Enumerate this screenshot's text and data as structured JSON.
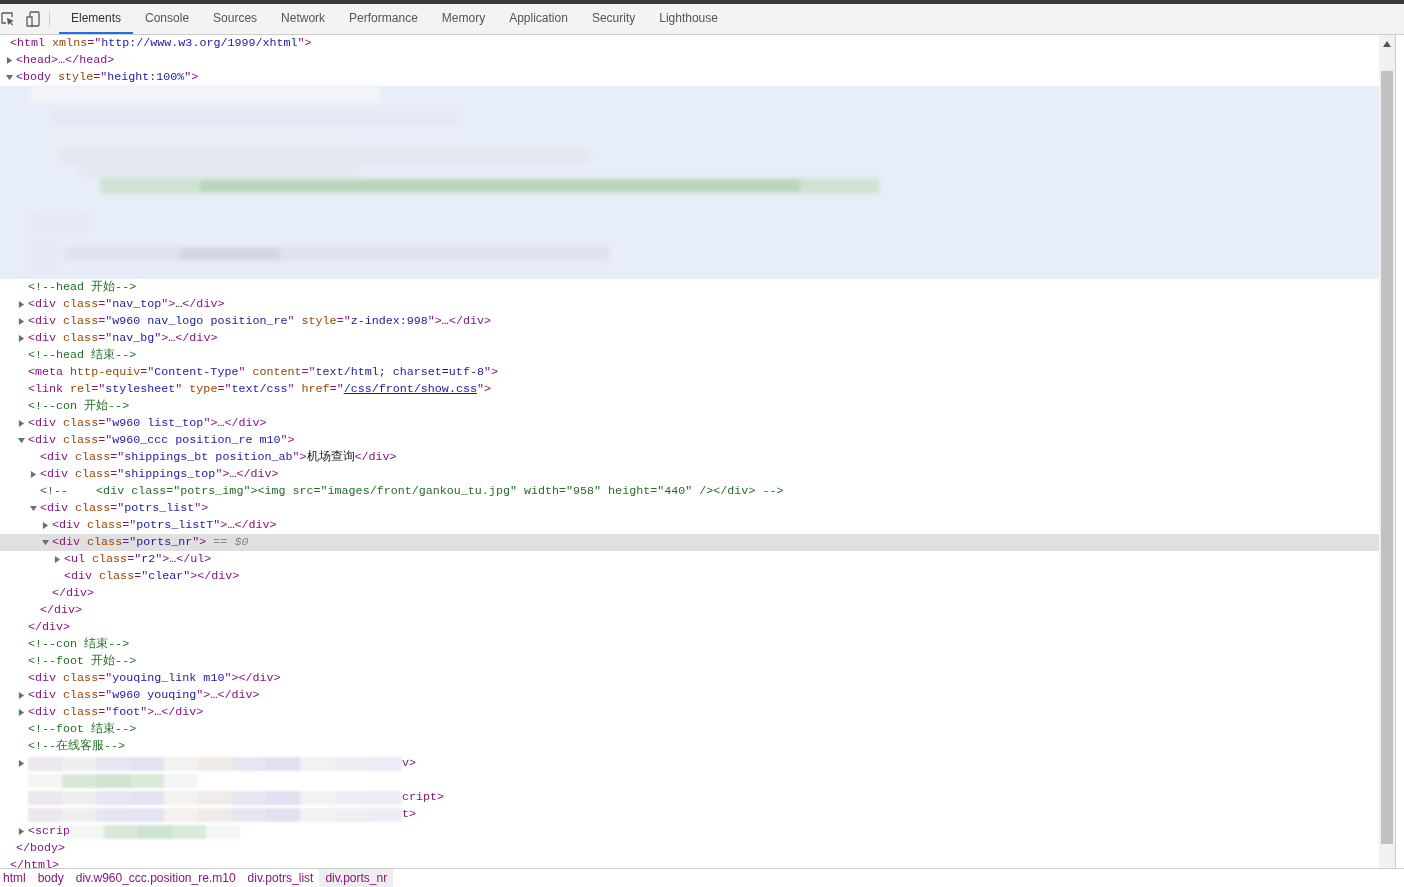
{
  "toolbar": {
    "tabs": [
      {
        "label": "Elements",
        "selected": true
      },
      {
        "label": "Console",
        "selected": false
      },
      {
        "label": "Sources",
        "selected": false
      },
      {
        "label": "Network",
        "selected": false
      },
      {
        "label": "Performance",
        "selected": false
      },
      {
        "label": "Memory",
        "selected": false
      },
      {
        "label": "Application",
        "selected": false
      },
      {
        "label": "Security",
        "selected": false
      },
      {
        "label": "Lighthouse",
        "selected": false
      }
    ]
  },
  "tree": [
    {
      "kind": "element",
      "parts": [
        {
          "kind": "tag",
          "text": "<html"
        },
        {
          "kind": "attr",
          "text": " xmlns"
        },
        {
          "kind": "tag",
          "text": "=\""
        },
        {
          "kind": "value",
          "text": "http://www.w3.org/1999/xhtml"
        },
        {
          "kind": "tag",
          "text": "\">"
        }
      ],
      "children": [
        {
          "kind": "element",
          "expanded": false,
          "parts": [
            {
              "kind": "tag",
              "text": "<head>"
            },
            {
              "kind": "text",
              "text": "…"
            },
            {
              "kind": "tag",
              "text": "</head>"
            }
          ]
        },
        {
          "kind": "element",
          "expanded": true,
          "parts": [
            {
              "kind": "tag",
              "text": "<body"
            },
            {
              "kind": "attr",
              "text": " style"
            },
            {
              "kind": "tag",
              "text": "=\""
            },
            {
              "kind": "value",
              "text": "height:100%"
            },
            {
              "kind": "tag",
              "text": "\">"
            }
          ],
          "closing": [
            {
              "kind": "tag",
              "text": "</body>"
            }
          ],
          "children": [
            {
              "kind": "redacted_block",
              "highlighted": true
            },
            {
              "kind": "element",
              "parts": [
                {
                  "kind": "comment",
                  "text": "<!--head 开始-->"
                }
              ]
            },
            {
              "kind": "element",
              "expanded": false,
              "parts": [
                {
                  "kind": "tag",
                  "text": "<div"
                },
                {
                  "kind": "attr",
                  "text": " class"
                },
                {
                  "kind": "tag",
                  "text": "=\""
                },
                {
                  "kind": "value",
                  "text": "nav_top"
                },
                {
                  "kind": "tag",
                  "text": "\">"
                },
                {
                  "kind": "text",
                  "text": "…"
                },
                {
                  "kind": "tag",
                  "text": "</div>"
                }
              ]
            },
            {
              "kind": "element",
              "expanded": false,
              "parts": [
                {
                  "kind": "tag",
                  "text": "<div"
                },
                {
                  "kind": "attr",
                  "text": " class"
                },
                {
                  "kind": "tag",
                  "text": "=\""
                },
                {
                  "kind": "value",
                  "text": "w960 nav_logo position_re"
                },
                {
                  "kind": "tag",
                  "text": "\""
                },
                {
                  "kind": "attr",
                  "text": " style"
                },
                {
                  "kind": "tag",
                  "text": "=\""
                },
                {
                  "kind": "value",
                  "text": "z-index:998"
                },
                {
                  "kind": "tag",
                  "text": "\">"
                },
                {
                  "kind": "text",
                  "text": "…"
                },
                {
                  "kind": "tag",
                  "text": "</div>"
                }
              ]
            },
            {
              "kind": "element",
              "expanded": false,
              "parts": [
                {
                  "kind": "tag",
                  "text": "<div"
                },
                {
                  "kind": "attr",
                  "text": " class"
                },
                {
                  "kind": "tag",
                  "text": "=\""
                },
                {
                  "kind": "value",
                  "text": "nav_bg"
                },
                {
                  "kind": "tag",
                  "text": "\">"
                },
                {
                  "kind": "text",
                  "text": "…"
                },
                {
                  "kind": "tag",
                  "text": "</div>"
                }
              ]
            },
            {
              "kind": "element",
              "parts": [
                {
                  "kind": "comment",
                  "text": "<!--head 结束-->"
                }
              ]
            },
            {
              "kind": "element",
              "parts": [
                {
                  "kind": "tag",
                  "text": "<meta"
                },
                {
                  "kind": "attr",
                  "text": " http-equiv"
                },
                {
                  "kind": "tag",
                  "text": "=\""
                },
                {
                  "kind": "value",
                  "text": "Content-Type"
                },
                {
                  "kind": "tag",
                  "text": "\""
                },
                {
                  "kind": "attr",
                  "text": " content"
                },
                {
                  "kind": "tag",
                  "text": "=\""
                },
                {
                  "kind": "value",
                  "text": "text/html; charset=utf-8"
                },
                {
                  "kind": "tag",
                  "text": "\">"
                }
              ]
            },
            {
              "kind": "element",
              "parts": [
                {
                  "kind": "tag",
                  "text": "<link"
                },
                {
                  "kind": "attr",
                  "text": " rel"
                },
                {
                  "kind": "tag",
                  "text": "=\""
                },
                {
                  "kind": "value",
                  "text": "stylesheet"
                },
                {
                  "kind": "tag",
                  "text": "\""
                },
                {
                  "kind": "attr",
                  "text": " type"
                },
                {
                  "kind": "tag",
                  "text": "=\""
                },
                {
                  "kind": "value",
                  "text": "text/css"
                },
                {
                  "kind": "tag",
                  "text": "\""
                },
                {
                  "kind": "attr",
                  "text": " href"
                },
                {
                  "kind": "tag",
                  "text": "=\""
                },
                {
                  "kind": "link",
                  "text": "/css/front/show.css"
                },
                {
                  "kind": "tag",
                  "text": "\">"
                }
              ]
            },
            {
              "kind": "element",
              "parts": [
                {
                  "kind": "comment",
                  "text": "<!--con 开始-->"
                }
              ]
            },
            {
              "kind": "element",
              "expanded": false,
              "parts": [
                {
                  "kind": "tag",
                  "text": "<div"
                },
                {
                  "kind": "attr",
                  "text": " class"
                },
                {
                  "kind": "tag",
                  "text": "=\""
                },
                {
                  "kind": "value",
                  "text": "w960 list_top"
                },
                {
                  "kind": "tag",
                  "text": "\">"
                },
                {
                  "kind": "text",
                  "text": "…"
                },
                {
                  "kind": "tag",
                  "text": "</div>"
                }
              ]
            },
            {
              "kind": "element",
              "expanded": true,
              "parts": [
                {
                  "kind": "tag",
                  "text": "<div"
                },
                {
                  "kind": "attr",
                  "text": " class"
                },
                {
                  "kind": "tag",
                  "text": "=\""
                },
                {
                  "kind": "value",
                  "text": "w960_ccc position_re m10"
                },
                {
                  "kind": "tag",
                  "text": "\">"
                }
              ],
              "closing": [
                {
                  "kind": "tag",
                  "text": "</div>"
                }
              ],
              "children": [
                {
                  "kind": "element",
                  "parts": [
                    {
                      "kind": "tag",
                      "text": "<div"
                    },
                    {
                      "kind": "attr",
                      "text": " class"
                    },
                    {
                      "kind": "tag",
                      "text": "=\""
                    },
                    {
                      "kind": "value",
                      "text": "shippings_bt position_ab"
                    },
                    {
                      "kind": "tag",
                      "text": "\">"
                    },
                    {
                      "kind": "text",
                      "text": "机场查询"
                    },
                    {
                      "kind": "tag",
                      "text": "</div>"
                    }
                  ]
                },
                {
                  "kind": "element",
                  "expanded": false,
                  "parts": [
                    {
                      "kind": "tag",
                      "text": "<div"
                    },
                    {
                      "kind": "attr",
                      "text": " class"
                    },
                    {
                      "kind": "tag",
                      "text": "=\""
                    },
                    {
                      "kind": "value",
                      "text": "shippings_top"
                    },
                    {
                      "kind": "tag",
                      "text": "\">"
                    },
                    {
                      "kind": "text",
                      "text": "…"
                    },
                    {
                      "kind": "tag",
                      "text": "</div>"
                    }
                  ]
                },
                {
                  "kind": "element",
                  "parts": [
                    {
                      "kind": "comment",
                      "text": "<!--    <div class=\"potrs_img\"><img src=\"images/front/gankou_tu.jpg\" width=\"958\" height=\"440\" /></div> -->"
                    }
                  ]
                },
                {
                  "kind": "element",
                  "expanded": true,
                  "parts": [
                    {
                      "kind": "tag",
                      "text": "<div"
                    },
                    {
                      "kind": "attr",
                      "text": " class"
                    },
                    {
                      "kind": "tag",
                      "text": "=\""
                    },
                    {
                      "kind": "value",
                      "text": "potrs_list"
                    },
                    {
                      "kind": "tag",
                      "text": "\">"
                    }
                  ],
                  "closing": [
                    {
                      "kind": "tag",
                      "text": "</div>"
                    }
                  ],
                  "children": [
                    {
                      "kind": "element",
                      "expanded": false,
                      "parts": [
                        {
                          "kind": "tag",
                          "text": "<div"
                        },
                        {
                          "kind": "attr",
                          "text": " class"
                        },
                        {
                          "kind": "tag",
                          "text": "=\""
                        },
                        {
                          "kind": "value",
                          "text": "potrs_listT"
                        },
                        {
                          "kind": "tag",
                          "text": "\">"
                        },
                        {
                          "kind": "text",
                          "text": "…"
                        },
                        {
                          "kind": "tag",
                          "text": "</div>"
                        }
                      ]
                    },
                    {
                      "kind": "element",
                      "expanded": true,
                      "selected": true,
                      "parts": [
                        {
                          "kind": "tag",
                          "text": "<div"
                        },
                        {
                          "kind": "attr",
                          "text": " class"
                        },
                        {
                          "kind": "tag",
                          "text": "=\""
                        },
                        {
                          "kind": "value",
                          "text": "ports_nr"
                        },
                        {
                          "kind": "tag",
                          "text": "\">"
                        },
                        {
                          "kind": "console_ref",
                          "text": " == $0"
                        }
                      ],
                      "closing": [
                        {
                          "kind": "tag",
                          "text": "</div>"
                        }
                      ],
                      "children": [
                        {
                          "kind": "element",
                          "expanded": false,
                          "parts": [
                            {
                              "kind": "tag",
                              "text": "<ul"
                            },
                            {
                              "kind": "attr",
                              "text": " class"
                            },
                            {
                              "kind": "tag",
                              "text": "=\""
                            },
                            {
                              "kind": "value",
                              "text": "r2"
                            },
                            {
                              "kind": "tag",
                              "text": "\">"
                            },
                            {
                              "kind": "text",
                              "text": "…"
                            },
                            {
                              "kind": "tag",
                              "text": "</ul>"
                            }
                          ]
                        },
                        {
                          "kind": "element",
                          "parts": [
                            {
                              "kind": "tag",
                              "text": "<div"
                            },
                            {
                              "kind": "attr",
                              "text": " class"
                            },
                            {
                              "kind": "tag",
                              "text": "=\""
                            },
                            {
                              "kind": "value",
                              "text": "clear"
                            },
                            {
                              "kind": "tag",
                              "text": "\">"
                            },
                            {
                              "kind": "tag",
                              "text": "</div>"
                            }
                          ]
                        }
                      ]
                    }
                  ]
                }
              ]
            },
            {
              "kind": "element",
              "parts": [
                {
                  "kind": "comment",
                  "text": "<!--con 结束-->"
                }
              ]
            },
            {
              "kind": "element",
              "parts": [
                {
                  "kind": "comment",
                  "text": "<!--foot 开始-->"
                }
              ]
            },
            {
              "kind": "element",
              "parts": [
                {
                  "kind": "tag",
                  "text": "<div"
                },
                {
                  "kind": "attr",
                  "text": " class"
                },
                {
                  "kind": "tag",
                  "text": "=\""
                },
                {
                  "kind": "value",
                  "text": "youqing_link m10"
                },
                {
                  "kind": "tag",
                  "text": "\">"
                },
                {
                  "kind": "tag",
                  "text": "</div>"
                }
              ]
            },
            {
              "kind": "element",
              "expanded": false,
              "parts": [
                {
                  "kind": "tag",
                  "text": "<div"
                },
                {
                  "kind": "attr",
                  "text": " class"
                },
                {
                  "kind": "tag",
                  "text": "=\""
                },
                {
                  "kind": "value",
                  "text": "w960 youqing"
                },
                {
                  "kind": "tag",
                  "text": "\">"
                },
                {
                  "kind": "text",
                  "text": "…"
                },
                {
                  "kind": "tag",
                  "text": "</div>"
                }
              ]
            },
            {
              "kind": "element",
              "expanded": false,
              "parts": [
                {
                  "kind": "tag",
                  "text": "<div"
                },
                {
                  "kind": "attr",
                  "text": " class"
                },
                {
                  "kind": "tag",
                  "text": "=\""
                },
                {
                  "kind": "value",
                  "text": "foot"
                },
                {
                  "kind": "tag",
                  "text": "\">"
                },
                {
                  "kind": "text",
                  "text": "…"
                },
                {
                  "kind": "tag",
                  "text": "</div>"
                }
              ]
            },
            {
              "kind": "element",
              "parts": [
                {
                  "kind": "comment",
                  "text": "<!--foot 结束-->"
                }
              ]
            },
            {
              "kind": "element",
              "parts": [
                {
                  "kind": "comment",
                  "text": "<!--在线客服-->"
                }
              ]
            },
            {
              "kind": "redacted_line",
              "expanded": false,
              "tail": "v>"
            },
            {
              "kind": "redacted_line"
            },
            {
              "kind": "redacted_line",
              "tail": "cript>"
            },
            {
              "kind": "redacted_line",
              "tail": "t>"
            },
            {
              "kind": "redacted_line",
              "expanded": false,
              "lead": "<scrip"
            }
          ]
        }
      ]
    }
  ],
  "html_closing": "</html>",
  "breadcrumbs": [
    {
      "label": "html",
      "selected": false
    },
    {
      "label": "body",
      "selected": false
    },
    {
      "label": "div.w960_ccc.position_re.m10",
      "selected": false
    },
    {
      "label": "div.potrs_list",
      "selected": false
    },
    {
      "label": "div.ports_nr",
      "selected": true
    }
  ]
}
